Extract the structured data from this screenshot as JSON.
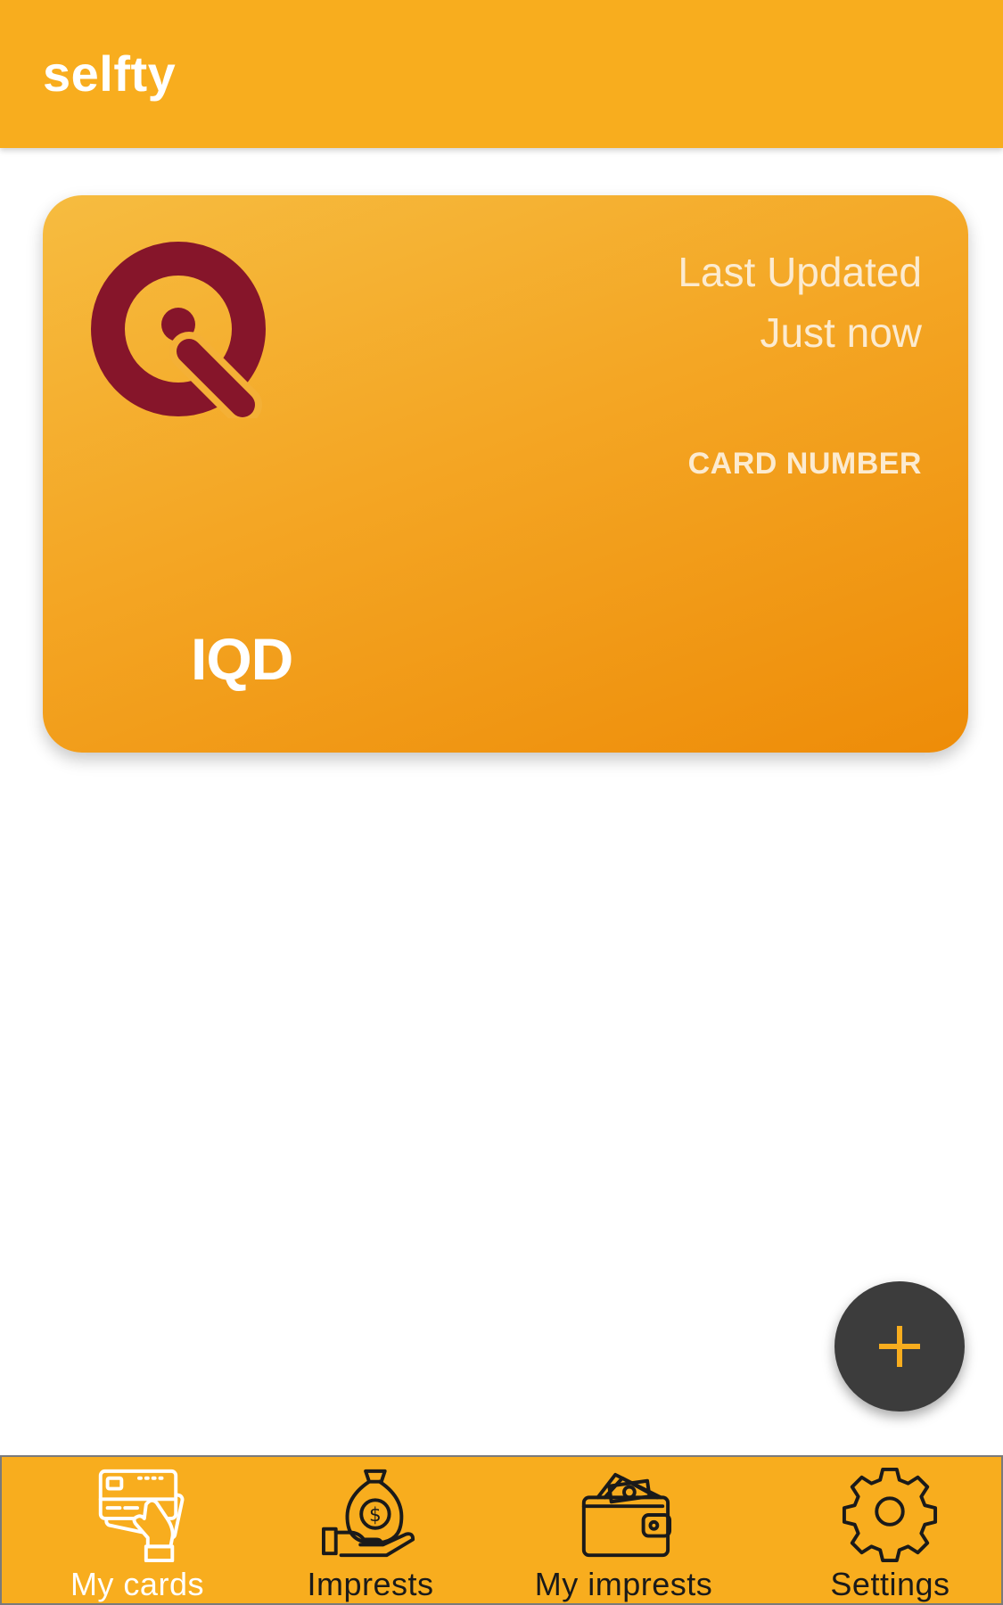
{
  "app_bar": {
    "title": "selfty"
  },
  "card": {
    "logo_icon": "iq-logo-icon",
    "last_updated_label": "Last Updated",
    "last_updated_value": "Just now",
    "card_number_label": "CARD NUMBER",
    "currency": "IQD",
    "colors": {
      "gradient_start": "#F6BC40",
      "gradient_end": "#EE8C08",
      "logo": "#86152A"
    }
  },
  "fab": {
    "icon": "plus-icon",
    "color": "#3C3C3C",
    "icon_color": "#F8AD1E"
  },
  "bottom_nav": {
    "active_index": 0,
    "items": [
      {
        "label": "My cards",
        "icon": "card-hand-icon"
      },
      {
        "label": "Imprests",
        "icon": "money-bag-hand-icon"
      },
      {
        "label": "My imprests",
        "icon": "wallet-icon"
      },
      {
        "label": "Settings",
        "icon": "gear-icon"
      }
    ]
  },
  "theme": {
    "primary": "#F8AD1E",
    "on_primary": "#FFFFFF"
  }
}
